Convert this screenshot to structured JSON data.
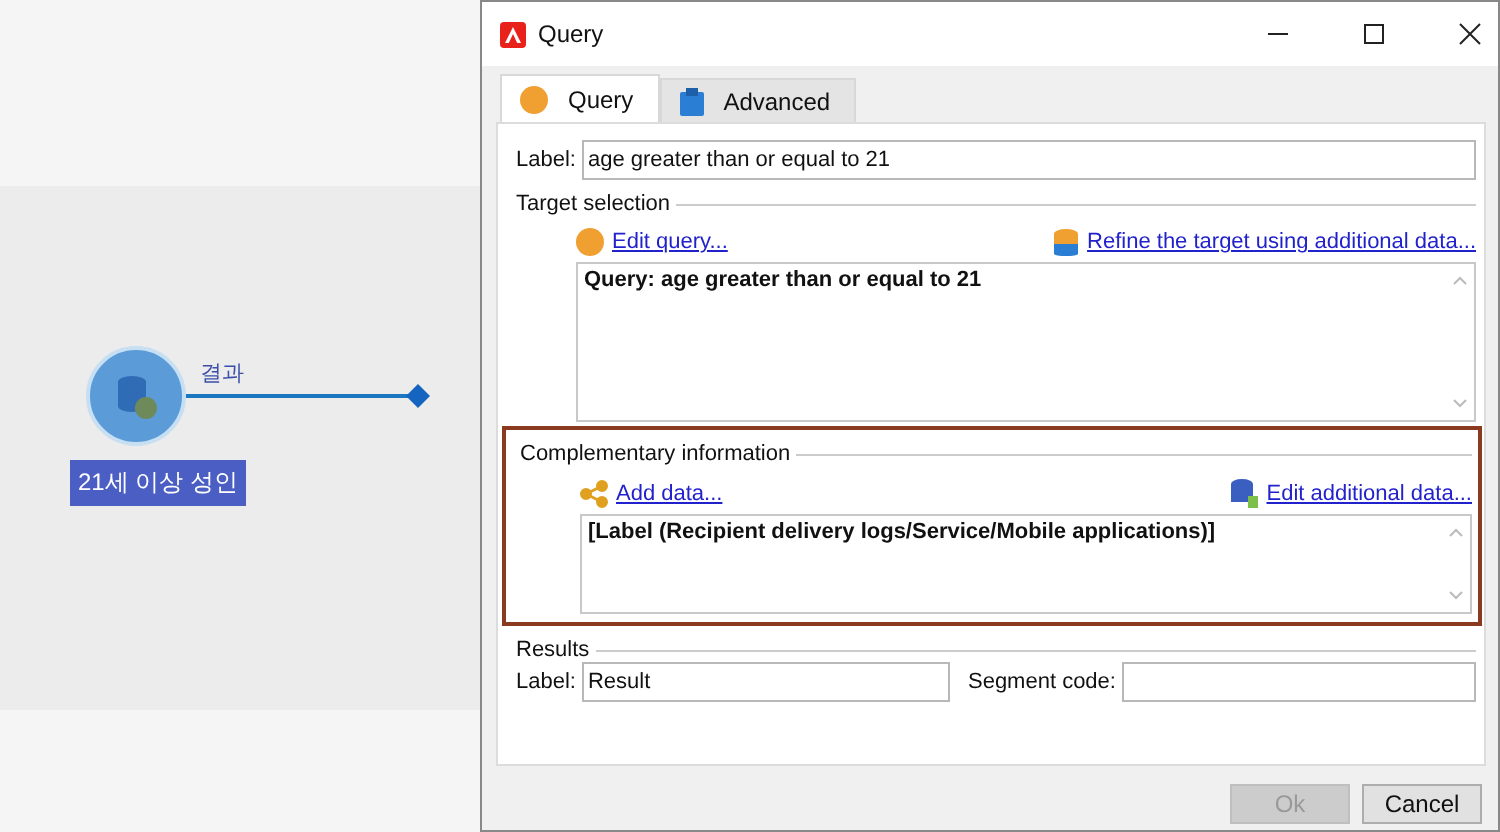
{
  "canvas": {
    "node": {
      "label": "21세 이상 성인",
      "transition": "결과"
    }
  },
  "window": {
    "title": "Query"
  },
  "tabs": [
    {
      "label": "Query",
      "selected": true,
      "kind": "query"
    },
    {
      "label": "Advanced",
      "selected": false,
      "kind": "advanced"
    }
  ],
  "label_field": {
    "label": "Label:",
    "value": "age greater than or equal to 21"
  },
  "target_selection": {
    "title": "Target selection",
    "left_link": "Edit query...",
    "right_link": "Refine the target using additional data...",
    "text": "Query: age greater than or equal to 21"
  },
  "complementary_information": {
    "title": "Complementary information",
    "highlighted": true,
    "left_link": "Add data...",
    "right_link": "Edit additional data...",
    "text": "[Label (Recipient delivery logs/Service/Mobile applications)]"
  },
  "results": {
    "title": "Results",
    "label": "Label:",
    "value": "Result",
    "segment_label": "Segment code:"
  },
  "buttons": [
    {
      "label": "Ok",
      "disabled": true
    },
    {
      "label": "Cancel",
      "disabled": false
    }
  ]
}
